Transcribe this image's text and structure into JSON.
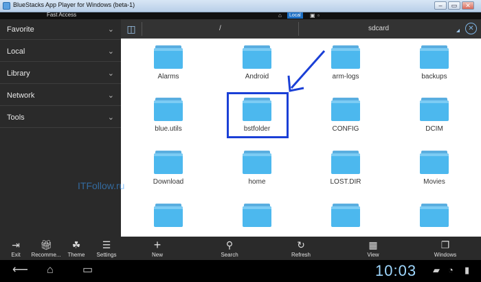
{
  "window": {
    "title": "BlueStacks App Player for Windows (beta-1)",
    "minimize": "–",
    "restore": "▭",
    "close": "✕"
  },
  "statusbar": {
    "fast_access": "Fast Access",
    "local": "Local"
  },
  "sidebar": {
    "items": [
      {
        "label": "Favorite"
      },
      {
        "label": "Local"
      },
      {
        "label": "Library"
      },
      {
        "label": "Network"
      },
      {
        "label": "Tools"
      }
    ]
  },
  "pathbar": {
    "root": "/",
    "current": "sdcard"
  },
  "folders": [
    {
      "name": "Alarms"
    },
    {
      "name": "Android"
    },
    {
      "name": "arm-logs"
    },
    {
      "name": "backups"
    },
    {
      "name": "blue.utils"
    },
    {
      "name": "bstfolder"
    },
    {
      "name": "CONFIG"
    },
    {
      "name": "DCIM"
    },
    {
      "name": "Download"
    },
    {
      "name": "home"
    },
    {
      "name": "LOST.DIR"
    },
    {
      "name": "Movies"
    },
    {
      "name": ""
    },
    {
      "name": ""
    },
    {
      "name": ""
    },
    {
      "name": ""
    }
  ],
  "watermark": "ITFollow.ru",
  "toolbar": {
    "exit": "Exit",
    "recommend": "Recomme...",
    "theme": "Theme",
    "settings": "Settings",
    "new": "New",
    "search": "Search",
    "refresh": "Refresh",
    "view": "View",
    "windows": "Windows"
  },
  "navbar": {
    "clock": "10:03"
  },
  "colors": {
    "accent": "#1a3fd6",
    "folder": "#4cb8ee"
  }
}
